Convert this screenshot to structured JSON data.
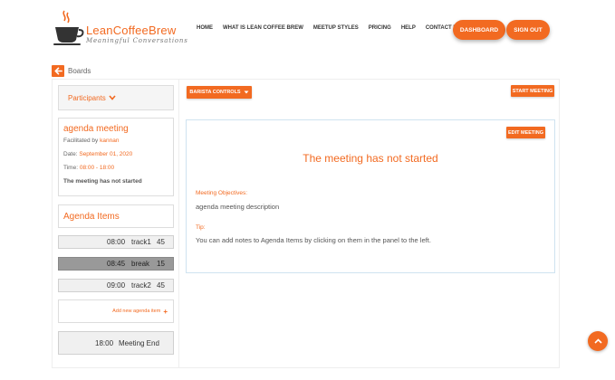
{
  "brand": {
    "name": "LeanCoffeeBrew",
    "tagline": "Meaningful Conversations",
    "accent_color": "#f26a21"
  },
  "nav": {
    "items": [
      "HOME",
      "WHAT IS LEAN COFFEE BREW",
      "MEETUP STYLES",
      "PRICING",
      "HELP",
      "CONTACT US"
    ],
    "dashboard_label": "DASHBOARD",
    "signout_label": "SIGN OUT"
  },
  "breadcrumb": {
    "back_icon": "arrow-left-icon",
    "label": "Boards"
  },
  "sidebar": {
    "participants_label": "Participants",
    "meeting": {
      "title": "agenda meeting",
      "facilitated_prefix": "Facilitated by",
      "facilitator": "kannan",
      "date_prefix": "Date:",
      "date": "September 01, 2020",
      "time_prefix": "Time:",
      "time": "08:00 - 18:00",
      "status": "The meeting has not started"
    },
    "agenda_title": "Agenda Items",
    "agenda_items": [
      {
        "time": "08:00",
        "name": "track1",
        "duration": "45",
        "active": false
      },
      {
        "time": "08:45",
        "name": "break",
        "duration": "15",
        "active": true
      },
      {
        "time": "09:00",
        "name": "track2",
        "duration": "45",
        "active": false
      }
    ],
    "add_item_label": "Add new agenda item",
    "end": {
      "time": "18:00",
      "label": "Meeting End"
    }
  },
  "toolbar": {
    "barista_label": "BARISTA CONTROLS",
    "start_label": "START MEETING"
  },
  "panel": {
    "edit_label": "EDIT MEETING",
    "heading": "The meeting has not started",
    "objectives_label": "Meeting Objectives:",
    "objectives_text": "agenda meeting description",
    "tip_label": "Tip:",
    "tip_text": "You can add notes to Agenda Items by clicking on them in the panel to the left."
  },
  "scroll_top_icon": "chevron-up-icon"
}
